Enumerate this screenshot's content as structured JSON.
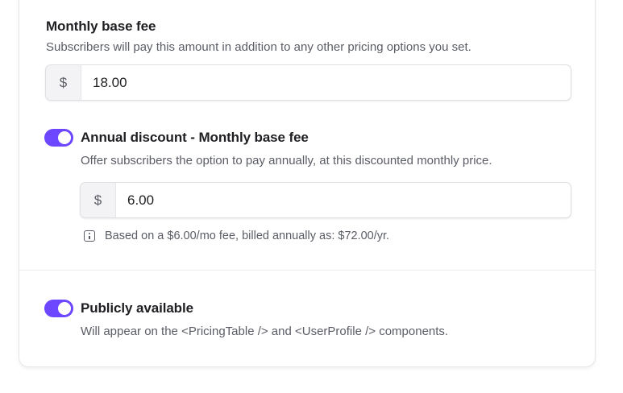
{
  "base_fee": {
    "title": "Monthly base fee",
    "description": "Subscribers will pay this amount in addition to any other pricing options you set.",
    "currency_symbol": "$",
    "value": "18.00"
  },
  "annual_discount": {
    "enabled": true,
    "title": "Annual discount - Monthly base fee",
    "description": "Offer subscribers the option to pay annually, at this discounted monthly price.",
    "currency_symbol": "$",
    "value": "6.00",
    "note": "Based on a $6.00/mo fee, billed annually as: $72.00/yr."
  },
  "public": {
    "enabled": true,
    "title": "Publicly available",
    "description": "Will appear on the <PricingTable /> and <UserProfile /> components."
  },
  "colors": {
    "accent": "#6c47ff",
    "text": "#1f1f23",
    "muted": "#5b5d66"
  }
}
